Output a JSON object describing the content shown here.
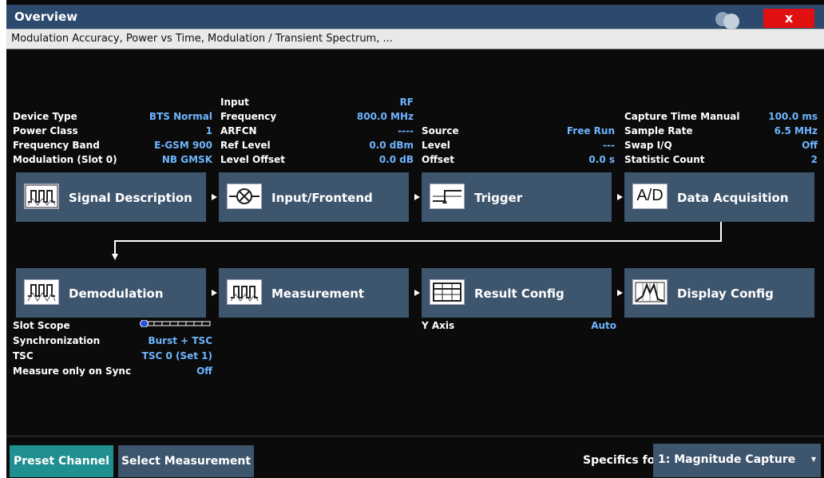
{
  "window": {
    "title": "Overview",
    "close_label": "x",
    "subtitle": "Modulation Accuracy, Power vs Time, Modulation / Transient Spectrum, ..."
  },
  "signal_description": {
    "rows": [
      {
        "label": "Device Type",
        "value": "BTS Normal"
      },
      {
        "label": "Power Class",
        "value": "1"
      },
      {
        "label": "Frequency Band",
        "value": "E-GSM 900"
      },
      {
        "label": "Modulation (Slot 0)",
        "value": "NB GMSK"
      }
    ]
  },
  "input": {
    "rows": [
      {
        "label": "Input",
        "value": "RF"
      },
      {
        "label": "Frequency",
        "value": "800.0 MHz"
      },
      {
        "label": "ARFCN",
        "value": "----"
      },
      {
        "label": "Ref Level",
        "value": "0.0 dBm"
      },
      {
        "label": "Level Offset",
        "value": "0.0 dB"
      }
    ]
  },
  "trigger": {
    "rows": [
      {
        "label": "Source",
        "value": "Free Run"
      },
      {
        "label": "Level",
        "value": "---"
      },
      {
        "label": "Offset",
        "value": "0.0 s"
      }
    ]
  },
  "acquisition": {
    "rows": [
      {
        "label": "Capture Time Manual",
        "value": "100.0 ms"
      },
      {
        "label": "Sample Rate",
        "value": "6.5 MHz"
      },
      {
        "label": "Swap I/Q",
        "value": "Off"
      },
      {
        "label": "Statistic Count",
        "value": "2"
      }
    ]
  },
  "blocks": {
    "signal_description": "Signal Description",
    "input_frontend": "Input/Frontend",
    "trigger": "Trigger",
    "data_acquisition": "Data Acquisition",
    "demodulation": "Demodulation",
    "measurement": "Measurement",
    "result_config": "Result Config",
    "display_config": "Display Config"
  },
  "icon_text": {
    "ad": "A/D"
  },
  "demod": {
    "rows": [
      {
        "label": "Slot Scope",
        "value": ""
      },
      {
        "label": "Synchronization",
        "value": "Burst + TSC"
      },
      {
        "label": "TSC",
        "value": "TSC 0 (Set 1)"
      },
      {
        "label": "Measure only on Sync",
        "value": "Off"
      }
    ]
  },
  "result": {
    "rows": [
      {
        "label": "Y Axis",
        "value": "Auto"
      }
    ]
  },
  "bottom": {
    "preset_channel": "Preset Channel",
    "select_measurement": "Select Measurement",
    "specifics_label": "Specifics for",
    "specifics_value": "1: Magnitude Capture",
    "dropdown_glyph": "▾"
  },
  "colors": {
    "title_bar": "#2c4a6e",
    "close": "#e01010",
    "block": "#3e556e",
    "value": "#6fb5ff",
    "preset_button": "#1f8f90",
    "dropdown": "#3e556e"
  }
}
